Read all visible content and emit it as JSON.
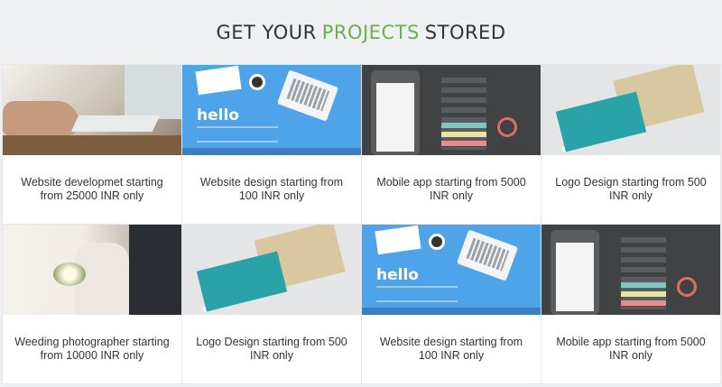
{
  "header": {
    "pre": "GET YOUR",
    "accent": "PROJECTS",
    "post": "STORED",
    "accent_color": "#6ab04c"
  },
  "cards": [
    {
      "caption": "Website developmet starting from 25000 INR only"
    },
    {
      "caption": "Website design starting from 100 INR only"
    },
    {
      "caption": "Mobile app starting from 5000 INR only"
    },
    {
      "caption": "Logo Design starting from 500 INR only"
    },
    {
      "caption": "Weeding photographer starting from 10000 INR only"
    },
    {
      "caption": "Logo Design starting from 500 INR only"
    },
    {
      "caption": "Website design starting from 100 INR only"
    },
    {
      "caption": "Mobile app starting from 5000 INR only"
    }
  ],
  "web_thumb_text": "hello"
}
